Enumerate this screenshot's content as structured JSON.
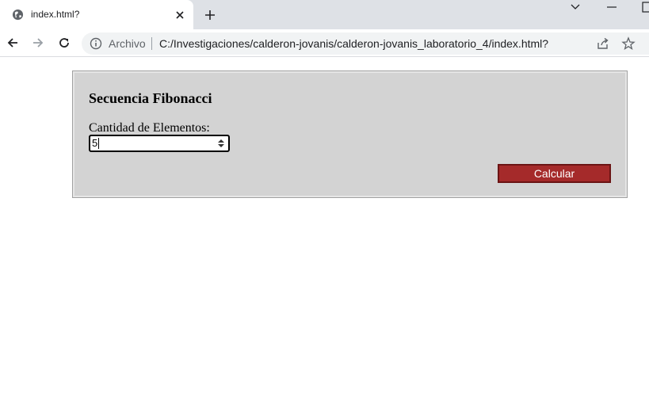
{
  "browser": {
    "tab": {
      "title": "index.html?"
    },
    "address_bar": {
      "scheme_label": "Archivo",
      "url": "C:/Investigaciones/calderon-jovanis/calderon-jovanis_laboratorio_4/index.html?"
    },
    "icons": {
      "favicon": "globe-icon",
      "close": "close-icon",
      "new_tab": "plus-icon",
      "back": "back-arrow-icon",
      "forward": "forward-arrow-icon",
      "reload": "reload-icon",
      "info": "info-icon",
      "share": "share-icon",
      "bookmark": "star-icon",
      "tab_search": "chevron-down-icon",
      "minimize": "minimize-icon",
      "maximize": "maximize-icon"
    }
  },
  "page": {
    "title": "Secuencia Fibonacci",
    "quantity_label": "Cantidad de Elementos:",
    "quantity_value": "5",
    "calculate_button": "Calcular"
  },
  "colors": {
    "panel_background": "#d3d3d3",
    "button_background": "#a52a2a",
    "button_text": "#ffffff"
  }
}
